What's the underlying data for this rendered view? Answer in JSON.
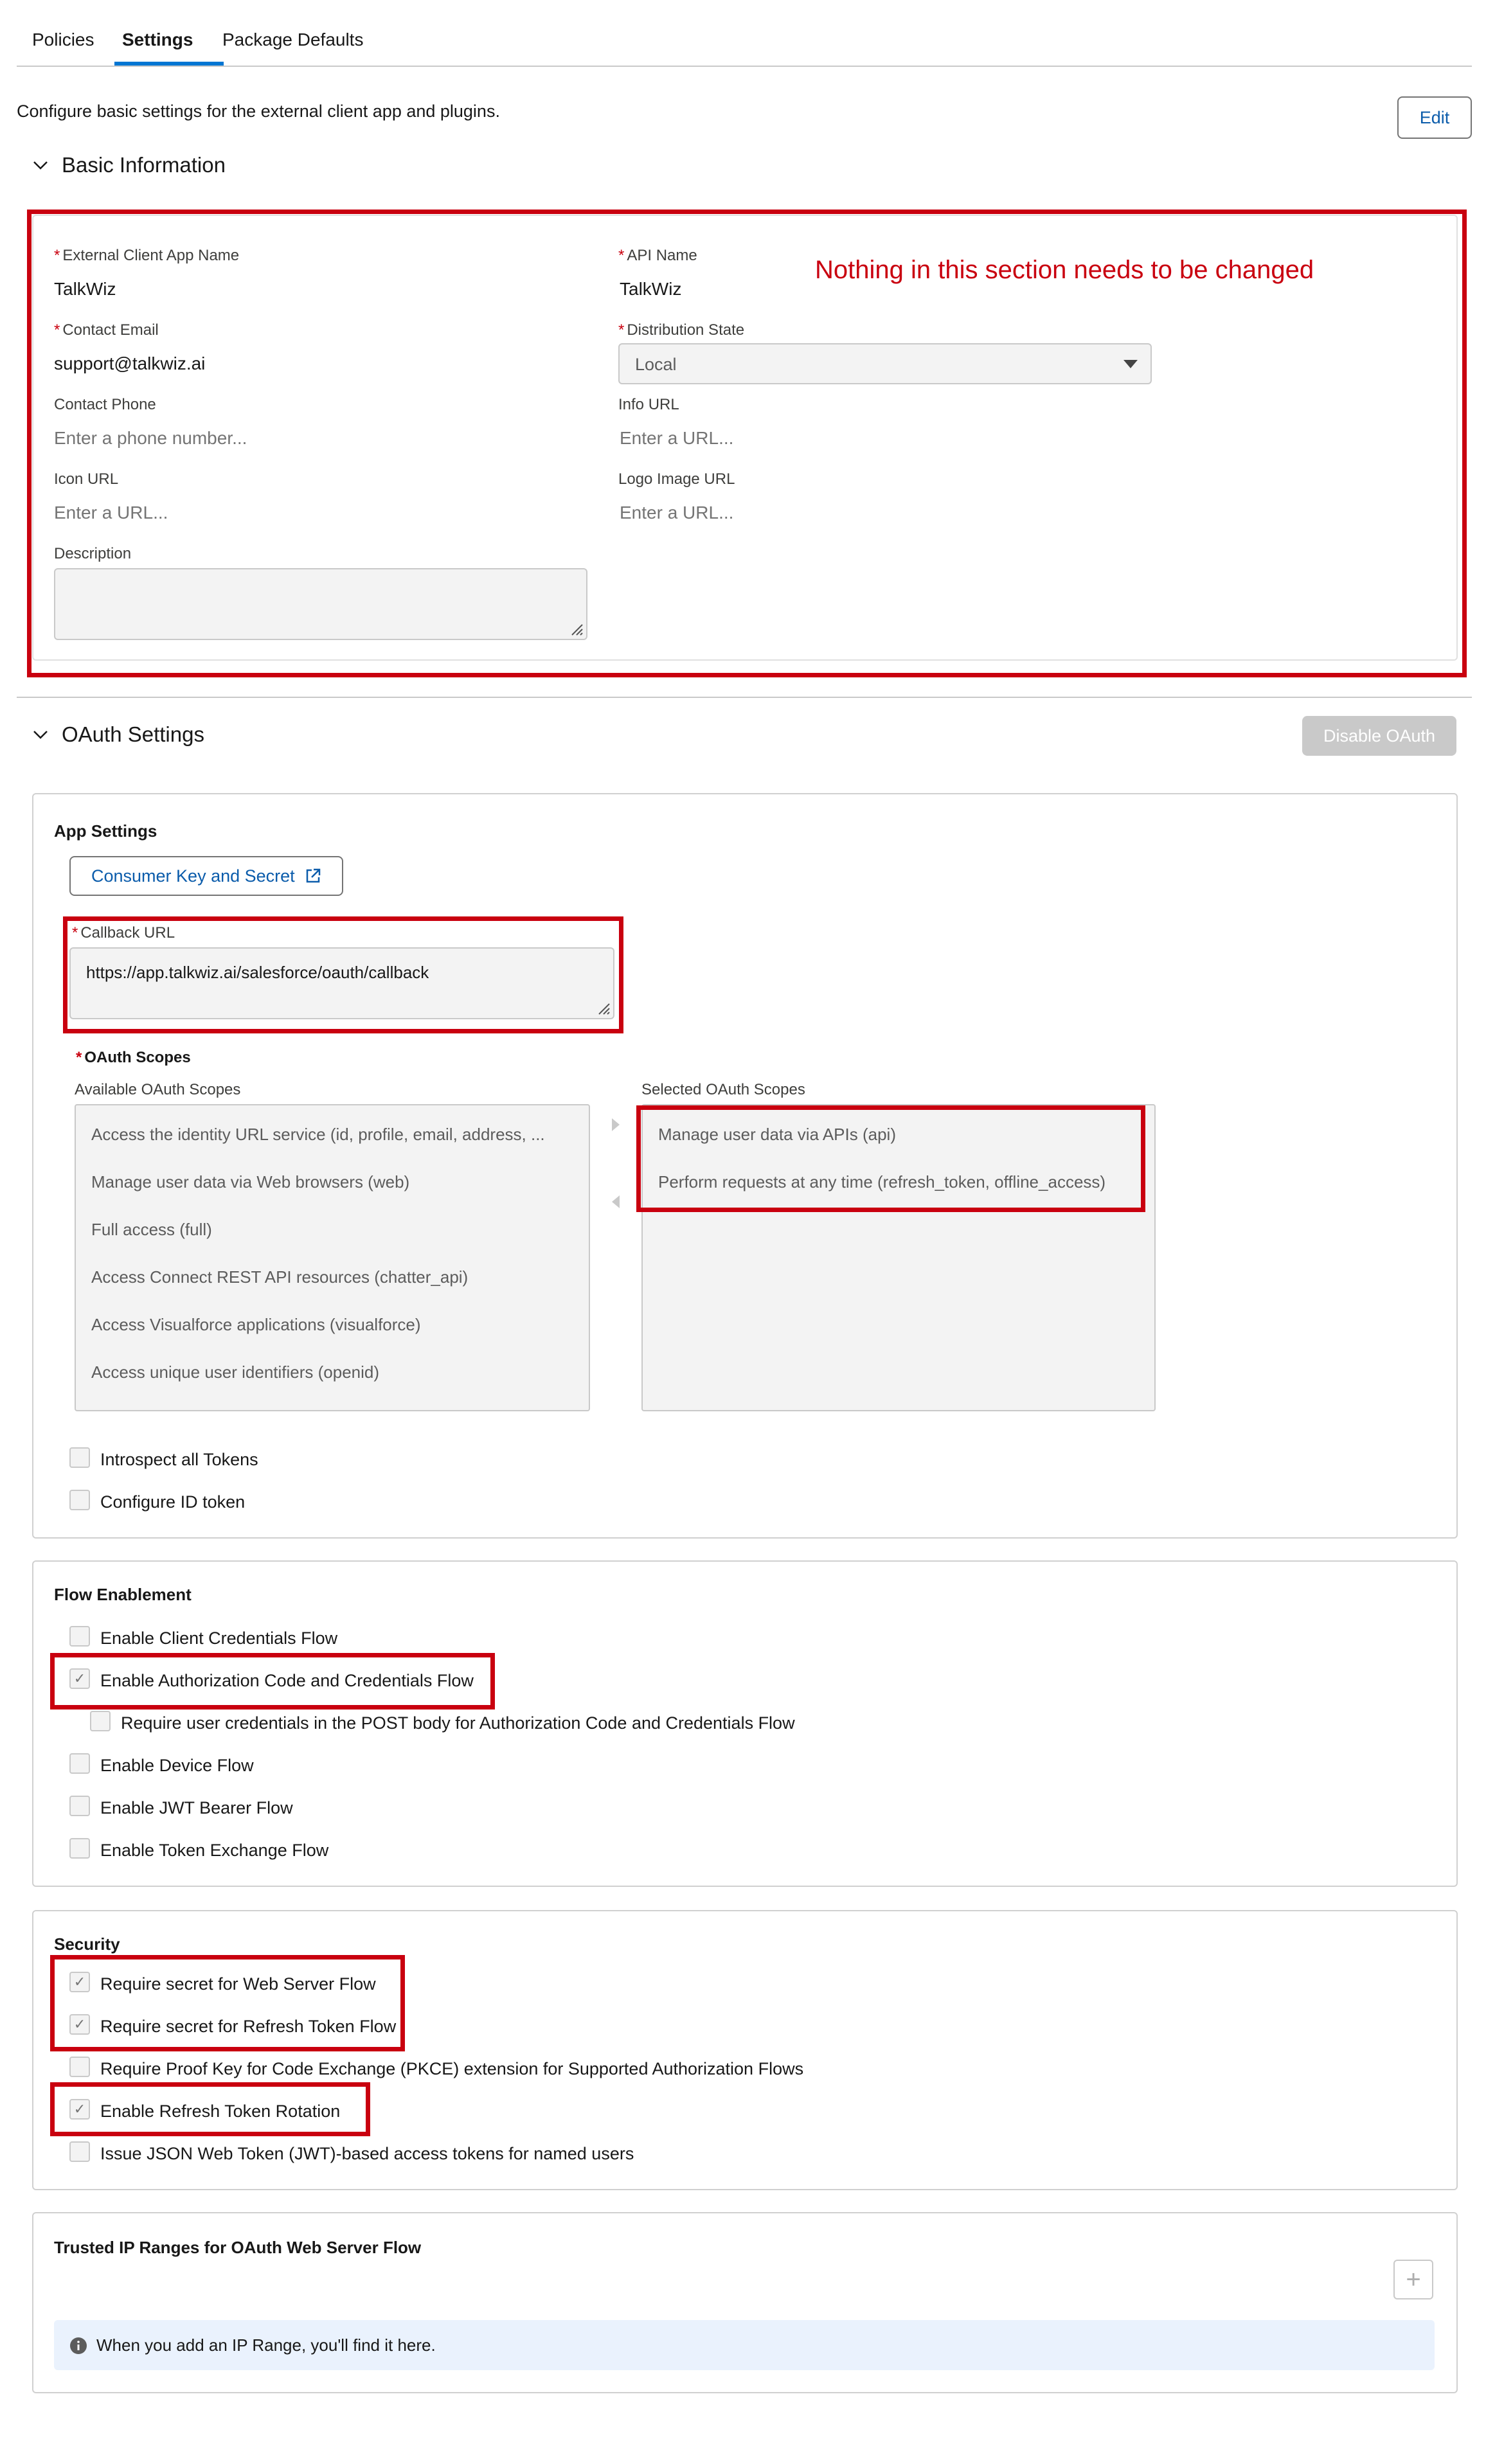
{
  "tabs": [
    "Policies",
    "Settings",
    "Package Defaults"
  ],
  "page_description": "Configure basic settings for the external client app and plugins.",
  "edit_label": "Edit",
  "basic_info": {
    "title": "Basic Information",
    "annotation": "Nothing in this section needs to be changed",
    "app_name_label": "External Client App Name",
    "app_name_value": "TalkWiz",
    "api_name_label": "API Name",
    "api_name_value": "TalkWiz",
    "contact_email_label": "Contact Email",
    "contact_email_value": "support@talkwiz.ai",
    "distribution_label": "Distribution State",
    "distribution_value": "Local",
    "contact_phone_label": "Contact Phone",
    "contact_phone_placeholder": "Enter a phone number...",
    "info_url_label": "Info URL",
    "info_url_placeholder": "Enter a URL...",
    "icon_url_label": "Icon URL",
    "icon_url_placeholder": "Enter a URL...",
    "logo_url_label": "Logo Image URL",
    "logo_url_placeholder": "Enter a URL...",
    "description_label": "Description"
  },
  "oauth": {
    "title": "OAuth Settings",
    "disable_label": "Disable OAuth",
    "app_settings_title": "App Settings",
    "consumer_key_label": "Consumer Key and Secret",
    "callback_label": "Callback URL",
    "callback_value": "https://app.talkwiz.ai/salesforce/oauth/callback",
    "scopes_label": "OAuth Scopes",
    "available_label": "Available OAuth Scopes",
    "selected_label": "Selected OAuth Scopes",
    "available": [
      "Access the identity URL service (id, profile, email, address, ...",
      "Manage user data via Web browsers (web)",
      "Full access (full)",
      "Access Connect REST API resources (chatter_api)",
      "Access Visualforce applications (visualforce)",
      "Access unique user identifiers (openid)"
    ],
    "selected": [
      "Manage user data via APIs (api)",
      "Perform requests at any time (refresh_token, offline_access)"
    ],
    "introspect_label": "Introspect all Tokens",
    "config_id_label": "Configure ID token"
  },
  "flow": {
    "title": "Flow Enablement",
    "items": [
      {
        "label": "Enable Client Credentials Flow",
        "checked": false
      },
      {
        "label": "Enable Authorization Code and Credentials Flow",
        "checked": true
      },
      {
        "label": "Require user credentials in the POST body for Authorization Code and Credentials Flow",
        "checked": false
      },
      {
        "label": "Enable Device Flow",
        "checked": false
      },
      {
        "label": "Enable JWT Bearer Flow",
        "checked": false
      },
      {
        "label": "Enable Token Exchange Flow",
        "checked": false
      }
    ]
  },
  "security": {
    "title": "Security",
    "items": [
      {
        "label": "Require secret for Web Server Flow",
        "checked": true
      },
      {
        "label": "Require secret for Refresh Token Flow",
        "checked": true
      },
      {
        "label": "Require Proof Key for Code Exchange (PKCE) extension for Supported Authorization Flows",
        "checked": false
      },
      {
        "label": "Enable Refresh Token Rotation",
        "checked": true
      },
      {
        "label": "Issue JSON Web Token (JWT)-based access tokens for named users",
        "checked": false
      }
    ]
  },
  "trusted_ip": {
    "title": "Trusted IP Ranges for OAuth Web Server Flow",
    "info": "When you add an IP Range, you'll find it here."
  }
}
